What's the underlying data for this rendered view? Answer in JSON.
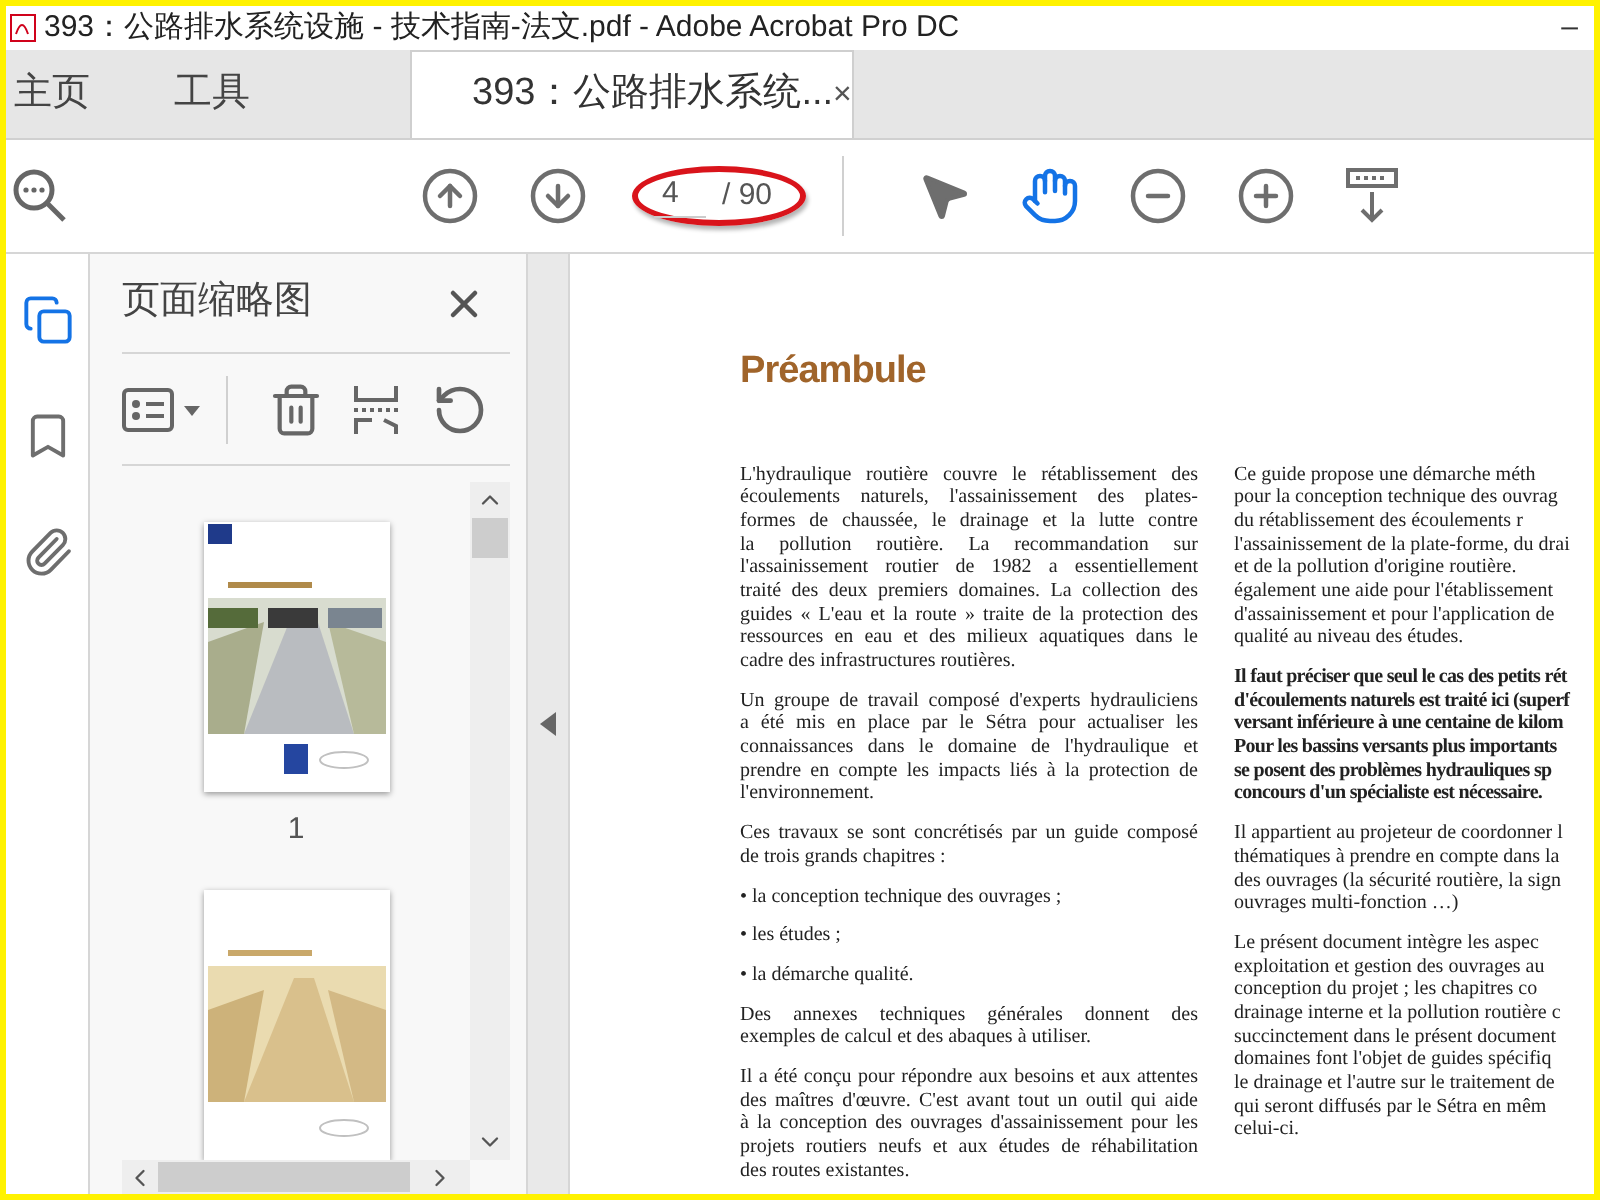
{
  "window": {
    "title": "393：公路排水系统设施 - 技术指南-法文.pdf - Adobe Acrobat Pro DC",
    "minimize": "–"
  },
  "tabs": [
    {
      "label": "主页",
      "selected": false
    },
    {
      "label": "工具",
      "selected": false
    },
    {
      "label": "393：公路排水系统...",
      "selected": true,
      "close": "×"
    }
  ],
  "toolbar": {
    "page_field": {
      "value": "4"
    },
    "page_total": "/ 90",
    "tools": [
      {
        "kind": "select",
        "selected": false
      },
      {
        "kind": "hand",
        "selected": true
      }
    ]
  },
  "rail": [
    {
      "kind": "pages",
      "selected": true
    },
    {
      "kind": "bookmarks",
      "selected": false
    },
    {
      "kind": "attachments",
      "selected": false
    }
  ],
  "panel": {
    "title": "页面缩略图",
    "thumbnails": [
      {
        "label": "1",
        "kind": "picture"
      },
      {
        "kind": "picture"
      }
    ]
  },
  "document": {
    "heading": "Préambule",
    "left_column": [
      {
        "kind": "plain",
        "lines": [
          "L'hydraulique routière couvre le rétablissement des",
          "écoulements naturels, l'assainissement des plates-",
          "formes de chaussée, le drainage et la lutte contre",
          "la pollution routière. La recommandation sur",
          "l'assainissement routier de 1982 a essentiellement",
          "traité des deux premiers domaines. La collection des",
          "guides « L'eau et la route » traite de la protection des",
          "ressources en eau et des milieux aquatiques dans le",
          "cadre des infrastructures routières."
        ]
      },
      {
        "kind": "plain",
        "lines": [
          "Un groupe de travail composé d'experts hydrauliciens",
          "a été mis en place par le Sétra pour actualiser les",
          "connaissances dans le domaine de l'hydraulique et",
          "prendre en compte les impacts liés à la protection de",
          "l'environnement."
        ]
      },
      {
        "kind": "plain",
        "lines": [
          "Ces travaux se sont concrétisés par un guide composé",
          "de trois grands chapitres :"
        ]
      },
      {
        "kind": "plain",
        "lines": [
          "• la conception technique des ouvrages ;"
        ]
      },
      {
        "kind": "plain",
        "lines": [
          "• les études ;"
        ]
      },
      {
        "kind": "plain",
        "lines": [
          "• la démarche qualité."
        ]
      },
      {
        "kind": "plain",
        "lines": [
          "Des annexes techniques générales donnent des",
          "exemples de calcul et des abaques à utiliser."
        ]
      },
      {
        "kind": "plain",
        "lines": [
          "Il a été conçu pour répondre aux besoins et aux attentes",
          "des maîtres d'œuvre. C'est avant tout un outil qui aide",
          "à la conception des ouvrages d'assainissement pour les",
          "projets routiers neufs et aux études de réhabilitation",
          "des routes existantes."
        ]
      }
    ],
    "right_column": [
      {
        "kind": "plain",
        "lines": [
          "Ce guide propose une démarche méth",
          "pour la conception technique des ouvrag",
          "du rétablissement des écoulements r",
          "l'assainissement de la plate-forme, du drai",
          "et de la pollution d'origine routière.",
          "également une aide pour l'établissement",
          "d'assainissement et pour l'application de",
          "qualité au niveau des études."
        ]
      },
      {
        "kind": "bold",
        "lines": [
          "Il faut préciser que seul le cas des petits rét",
          "d'écoulements naturels est traité ici (superf",
          "versant inférieure à une centaine de kilom",
          "Pour les bassins versants plus importants",
          "se posent des problèmes hydrauliques sp",
          "concours d'un spécialiste est nécessaire."
        ]
      },
      {
        "kind": "plain",
        "lines": [
          "Il appartient au projeteur de coordonner l",
          "thématiques à prendre en compte dans la",
          "des ouvrages (la sécurité routière, la sign",
          "ouvrages multi-fonction …)"
        ]
      },
      {
        "kind": "plain",
        "lines": [
          "Le présent document intègre les aspec",
          "exploitation et gestion des ouvrages au",
          "conception du projet ; les chapitres co",
          "drainage interne et la pollution routière c",
          "succinctement dans le présent document",
          "domaines font l'objet de guides spécifiq",
          "le drainage et l'autre sur le traitement de",
          "qui seront diffusés par le Sétra en mêm",
          "celui-ci."
        ]
      }
    ]
  }
}
